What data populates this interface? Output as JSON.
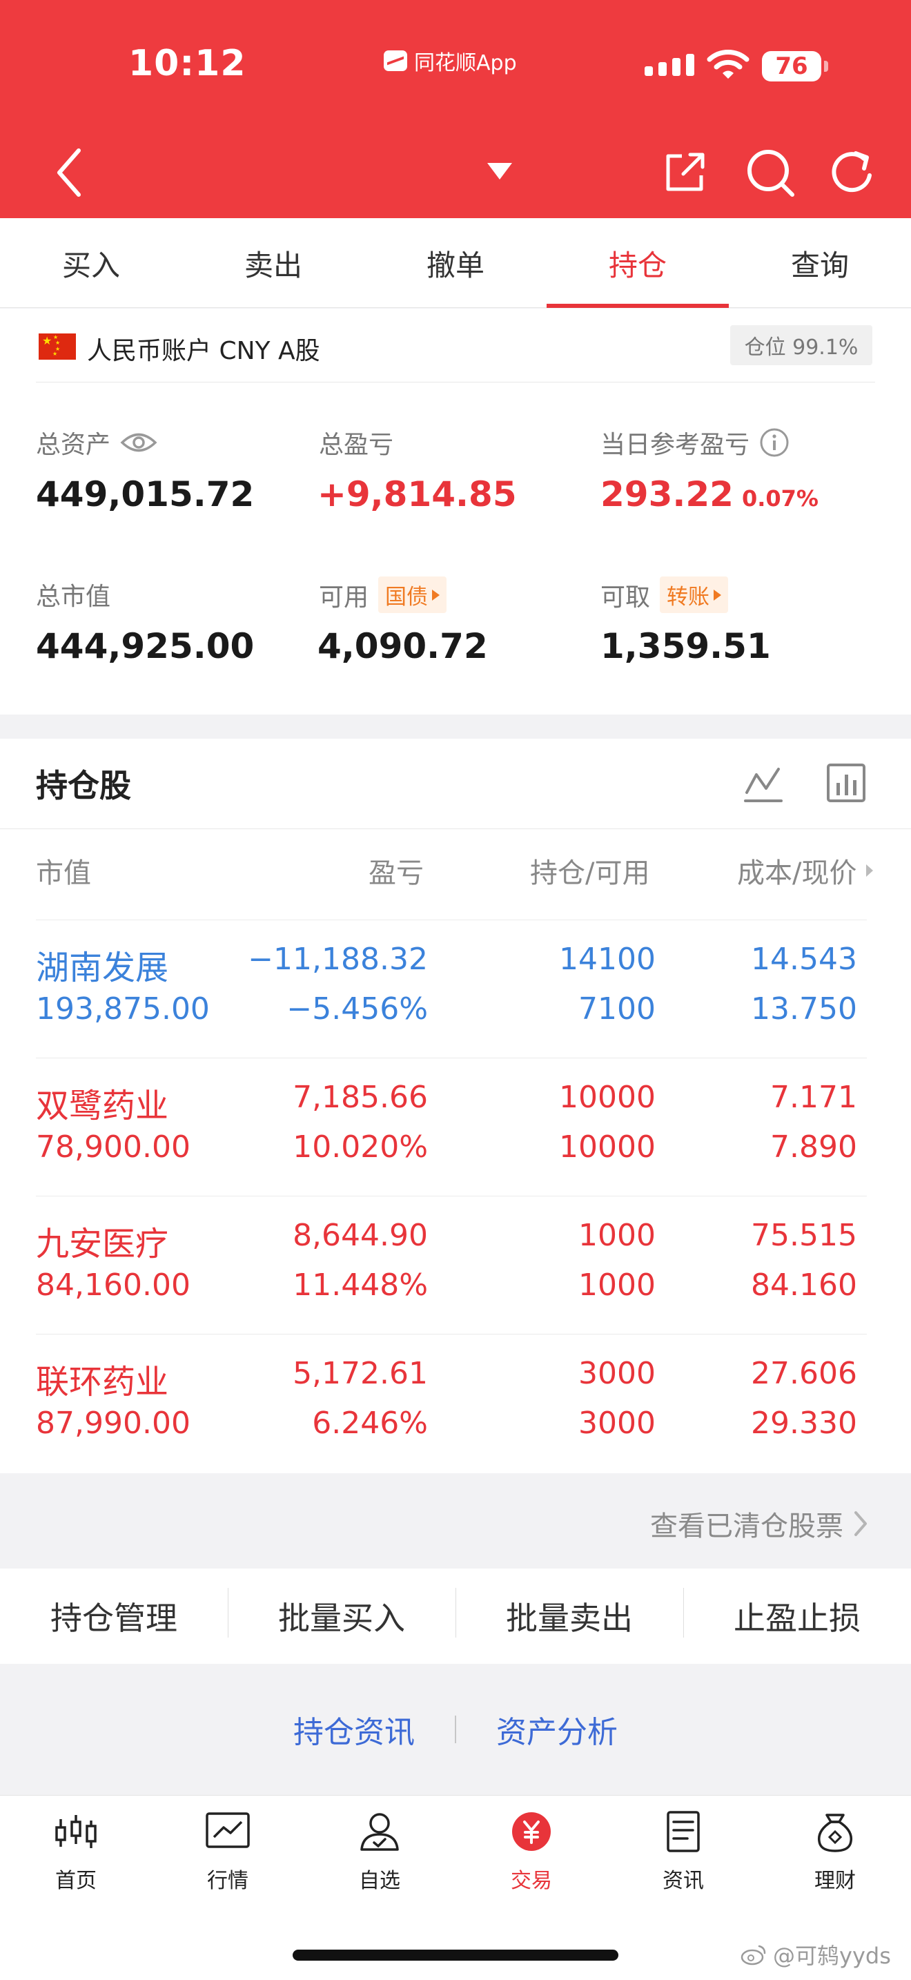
{
  "status_bar": {
    "time": "10:12",
    "app_name": "同花顺App",
    "battery": "76"
  },
  "tabs": [
    {
      "label": "买入"
    },
    {
      "label": "卖出"
    },
    {
      "label": "撤单"
    },
    {
      "label": "持仓"
    },
    {
      "label": "查询"
    }
  ],
  "account": {
    "label": "人民币账户 CNY A股",
    "position_ratio": "仓位 99.1%",
    "total_assets_label": "总资产",
    "total_assets": "449,015.72",
    "total_pnl_label": "总盈亏",
    "total_pnl": "+9,814.85",
    "daily_pnl_label": "当日参考盈亏",
    "daily_pnl": "293.22",
    "daily_pnl_pct": "0.07%",
    "market_value_label": "总市值",
    "market_value": "444,925.00",
    "available_label": "可用",
    "available_tag": "国债",
    "available": "4,090.72",
    "withdrawable_label": "可取",
    "withdrawable_tag": "转账",
    "withdrawable": "1,359.51"
  },
  "holdings": {
    "title": "持仓股",
    "columns": [
      "市值",
      "盈亏",
      "持仓/可用",
      "成本/现价"
    ],
    "rows": [
      {
        "name": "湖南发展",
        "market_value": "193,875.00",
        "pnl": "−11,188.32",
        "pnl_pct": "−5.456%",
        "position": "14100",
        "available": "7100",
        "cost": "14.543",
        "price": "13.750",
        "trend": "down"
      },
      {
        "name": "双鹭药业",
        "market_value": "78,900.00",
        "pnl": "7,185.66",
        "pnl_pct": "10.020%",
        "position": "10000",
        "available": "10000",
        "cost": "7.171",
        "price": "7.890",
        "trend": "up"
      },
      {
        "name": "九安医疗",
        "market_value": "84,160.00",
        "pnl": "8,644.90",
        "pnl_pct": "11.448%",
        "position": "1000",
        "available": "1000",
        "cost": "75.515",
        "price": "84.160",
        "trend": "up"
      },
      {
        "name": "联环药业",
        "market_value": "87,990.00",
        "pnl": "5,172.61",
        "pnl_pct": "6.246%",
        "position": "3000",
        "available": "3000",
        "cost": "27.606",
        "price": "29.330",
        "trend": "up"
      }
    ],
    "cleared_link": "查看已清仓股票"
  },
  "actions": [
    {
      "label": "持仓管理"
    },
    {
      "label": "批量买入"
    },
    {
      "label": "批量卖出"
    },
    {
      "label": "止盈止损"
    }
  ],
  "links": {
    "news": "持仓资讯",
    "analysis": "资产分析"
  },
  "tabbar": [
    {
      "label": "首页"
    },
    {
      "label": "行情"
    },
    {
      "label": "自选"
    },
    {
      "label": "交易"
    },
    {
      "label": "资讯"
    },
    {
      "label": "理财"
    }
  ],
  "watermark": "@可鸫yyds",
  "colors": {
    "brand_red": "#ee3b3f",
    "gain_red": "#e8343a",
    "loss_blue": "#3b82db",
    "tag_orange": "#f07a22",
    "link_blue": "#3d6ad6"
  }
}
